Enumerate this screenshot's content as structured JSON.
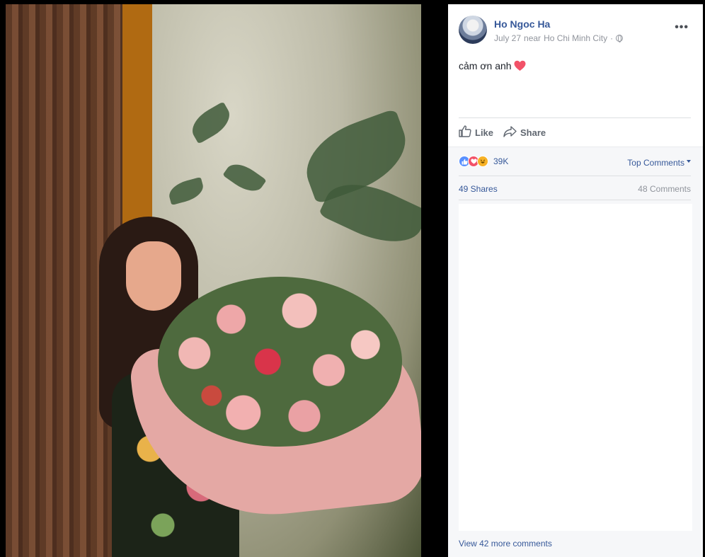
{
  "post": {
    "author": "Ho Ngoc Ha",
    "date": "July 27",
    "location_prefix": "near",
    "location": "Ho Chi Minh City",
    "privacy_separator": "·",
    "caption": "cảm ơn anh",
    "more_label": "•••"
  },
  "actions": {
    "like": "Like",
    "share": "Share"
  },
  "reactions": {
    "types": [
      "like-icon",
      "love-icon",
      "haha-icon"
    ],
    "count": "39K"
  },
  "comments_sort": "Top Comments",
  "stats": {
    "shares": "49 Shares",
    "comments": "48 Comments"
  },
  "view_more": "View 42 more comments",
  "colors": {
    "link": "#365899",
    "muted": "#90949c",
    "like": "#5890ff",
    "love": "#f25268",
    "haha": "#f7b125"
  }
}
